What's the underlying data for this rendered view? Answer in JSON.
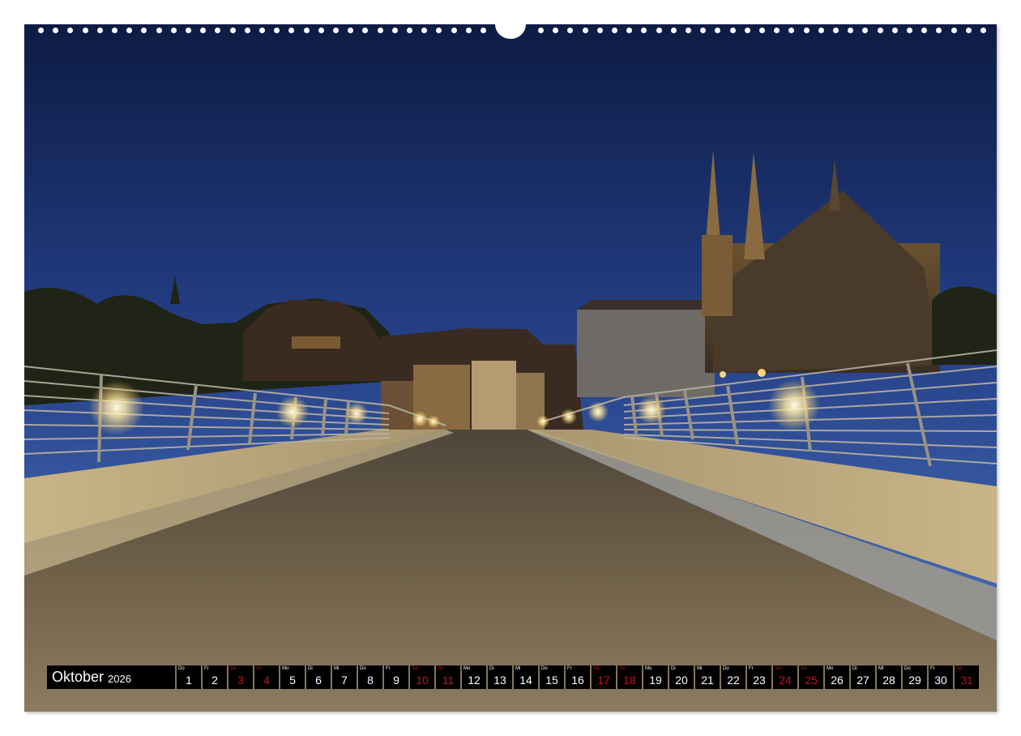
{
  "calendar": {
    "month": "Oktober",
    "year": "2026",
    "days": [
      {
        "num": "1",
        "dow": "Do",
        "red": false
      },
      {
        "num": "2",
        "dow": "Fr",
        "red": false
      },
      {
        "num": "3",
        "dow": "Sa",
        "red": true
      },
      {
        "num": "4",
        "dow": "So",
        "red": true
      },
      {
        "num": "5",
        "dow": "Mo",
        "red": false
      },
      {
        "num": "6",
        "dow": "Di",
        "red": false
      },
      {
        "num": "7",
        "dow": "Mi",
        "red": false
      },
      {
        "num": "8",
        "dow": "Do",
        "red": false
      },
      {
        "num": "9",
        "dow": "Fr",
        "red": false
      },
      {
        "num": "10",
        "dow": "Sa",
        "red": true
      },
      {
        "num": "11",
        "dow": "So",
        "red": true
      },
      {
        "num": "12",
        "dow": "Mo",
        "red": false
      },
      {
        "num": "13",
        "dow": "Di",
        "red": false
      },
      {
        "num": "14",
        "dow": "Mi",
        "red": false
      },
      {
        "num": "15",
        "dow": "Do",
        "red": false
      },
      {
        "num": "16",
        "dow": "Fr",
        "red": false
      },
      {
        "num": "17",
        "dow": "Sa",
        "red": true
      },
      {
        "num": "18",
        "dow": "So",
        "red": true
      },
      {
        "num": "19",
        "dow": "Mo",
        "red": false
      },
      {
        "num": "20",
        "dow": "Di",
        "red": false
      },
      {
        "num": "21",
        "dow": "Mi",
        "red": false
      },
      {
        "num": "22",
        "dow": "Do",
        "red": false
      },
      {
        "num": "23",
        "dow": "Fr",
        "red": false
      },
      {
        "num": "24",
        "dow": "Sa",
        "red": true
      },
      {
        "num": "25",
        "dow": "So",
        "red": true
      },
      {
        "num": "26",
        "dow": "Mo",
        "red": false
      },
      {
        "num": "27",
        "dow": "Di",
        "red": false
      },
      {
        "num": "28",
        "dow": "Mi",
        "red": false
      },
      {
        "num": "29",
        "dow": "Do",
        "red": false
      },
      {
        "num": "30",
        "dow": "Fr",
        "red": false
      },
      {
        "num": "31",
        "dow": "Sa",
        "red": true
      }
    ]
  },
  "colors": {
    "sky_top": "#0e1f4a",
    "sky_horizon": "#3d5fa8",
    "road": "#7a6a50",
    "sidewalk_glow": "#d9c28a",
    "lamp": "#fff6d0",
    "holiday": "#c0141c"
  }
}
